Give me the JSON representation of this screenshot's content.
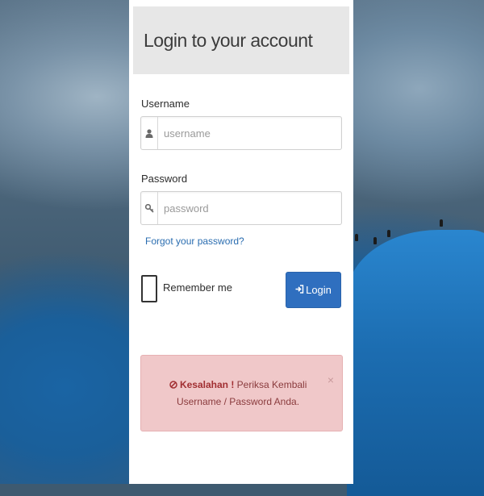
{
  "login_panel": {
    "title": "Login to your account",
    "username": {
      "label": "Username",
      "placeholder": "username",
      "value": "",
      "icon": "user-icon"
    },
    "password": {
      "label": "Password",
      "placeholder": "password",
      "value": "",
      "icon": "key-icon"
    },
    "forgot_link": "Forgot your password?",
    "remember_me": {
      "label": "Remember me",
      "checked": false
    },
    "login_button": {
      "label": "Login",
      "icon": "sign-in-icon",
      "color": "#2f6fbf"
    }
  },
  "alert": {
    "title": "Kesalahan !",
    "message": "Periksa Kembali Username / Password Anda.",
    "close_glyph": "×",
    "icon": "ban-icon",
    "background": "#f0c8c9"
  }
}
